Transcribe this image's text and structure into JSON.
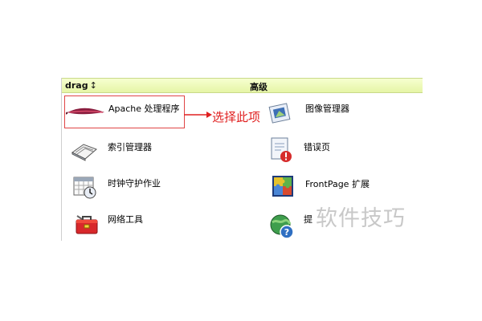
{
  "header": {
    "drag_label": "drag",
    "drag_arrow": "↕",
    "section_title": "高级"
  },
  "items": [
    {
      "label": "Apache 处理程序",
      "icon": "apache-feather-icon"
    },
    {
      "label": "图像管理器",
      "icon": "image-manager-icon"
    },
    {
      "label": "索引管理器",
      "icon": "index-manager-icon"
    },
    {
      "label": "错误页",
      "icon": "error-page-icon"
    },
    {
      "label": "时钟守护作业",
      "icon": "cron-calendar-icon"
    },
    {
      "label": "FrontPage 扩展",
      "icon": "frontpage-puzzle-icon"
    },
    {
      "label": "网络工具",
      "icon": "network-toolbox-icon"
    },
    {
      "label": "提",
      "icon": "help-globe-icon"
    }
  ],
  "annotation": {
    "text": "选择此项"
  },
  "watermark": {
    "text": "软件技巧"
  },
  "colors": {
    "header_bg": "#eef8b8",
    "highlight": "#e04545",
    "annotation": "#e02020",
    "watermark": "#c8c8c8"
  }
}
